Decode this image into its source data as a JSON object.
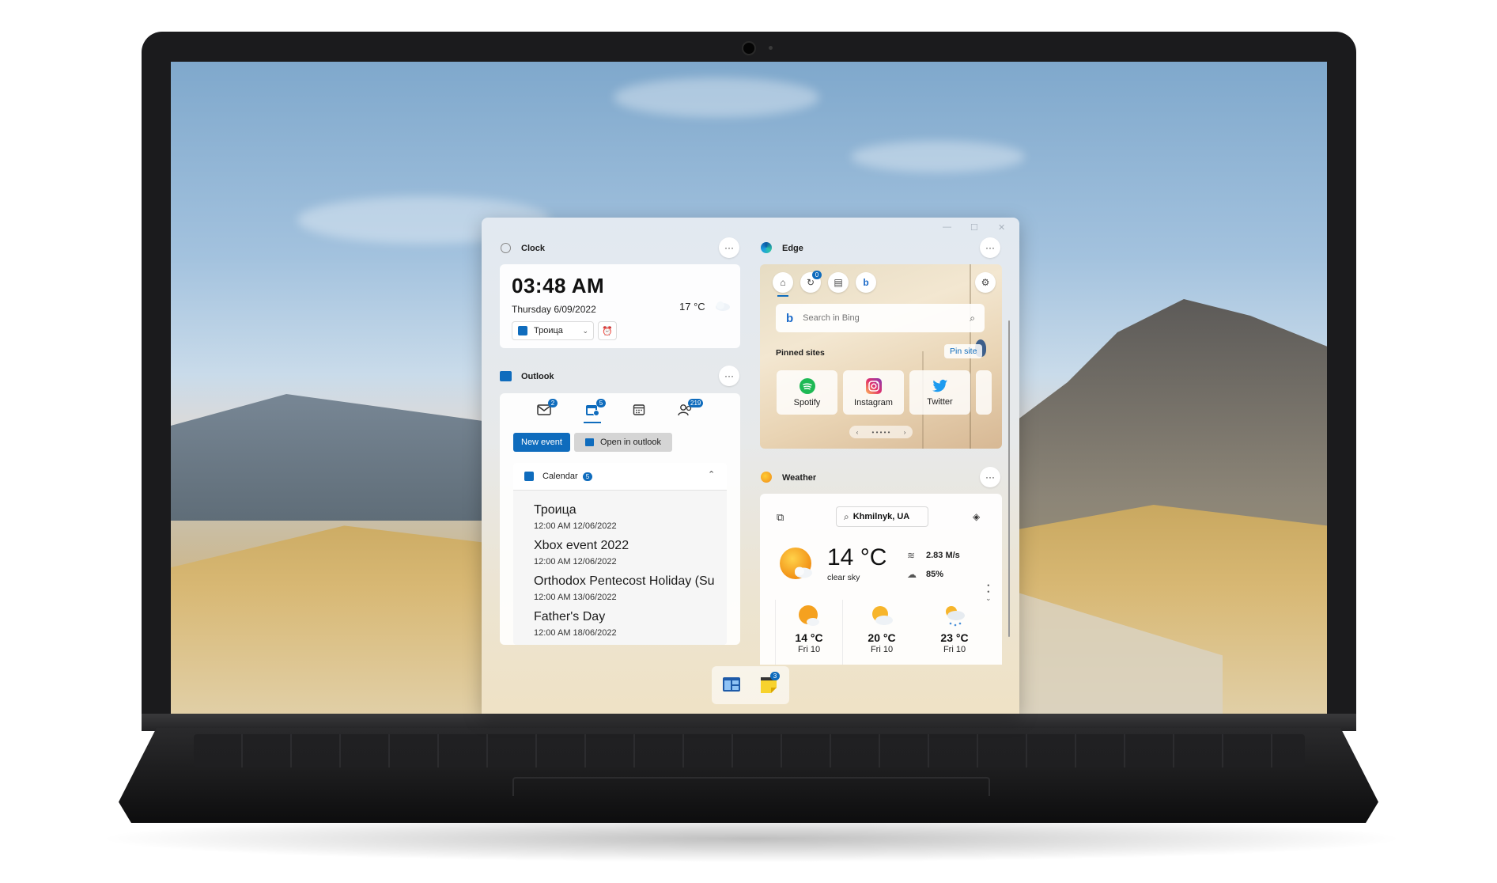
{
  "colors": {
    "accent": "#0f6cbd",
    "board_bg": "#e7e9ea"
  },
  "clock": {
    "title": "Clock",
    "time": "03:48 AM",
    "date": "Thursday 6/09/2022",
    "temperature": "17 °C",
    "event_selector": "Троица",
    "more": "···"
  },
  "outlook": {
    "title": "Outlook",
    "more": "···",
    "tabs": [
      {
        "icon": "mail-icon",
        "badge": "2"
      },
      {
        "icon": "calendar-event-icon",
        "badge": "5"
      },
      {
        "icon": "calendar-icon",
        "badge": ""
      },
      {
        "icon": "contacts-icon",
        "badge": "219"
      }
    ],
    "new_event": "New event",
    "open_in_outlook": "Open in outlook",
    "calendar_label": "Calendar",
    "calendar_count": "5",
    "events": [
      {
        "title": "Троица",
        "time": "12:00 AM 12/06/2022"
      },
      {
        "title": "Xbox event 2022",
        "time": "12:00 AM 12/06/2022"
      },
      {
        "title": "Orthodox Pentecost Holiday (Su",
        "time": "12:00 AM 13/06/2022"
      },
      {
        "title": "Father's Day",
        "time": "12:00 AM 18/06/2022"
      }
    ]
  },
  "edge": {
    "title": "Edge",
    "more": "···",
    "history_badge": "0",
    "search_placeholder": "Search in Bing",
    "pinned_sites_label": "Pinned sites",
    "pin_site": "Pin site",
    "sites": [
      {
        "name": "Spotify",
        "icon": "spotify-icon",
        "color": "#1db954"
      },
      {
        "name": "Instagram",
        "icon": "instagram-icon",
        "color": "#d6249f"
      },
      {
        "name": "Twitter",
        "icon": "twitter-icon",
        "color": "#1d9bf0"
      }
    ]
  },
  "weather": {
    "title": "Weather",
    "more": "···",
    "location": "Khmilnyk, UA",
    "temperature": "14 °C",
    "condition": "clear sky",
    "wind": "2.83  M/s",
    "humidity": "85%",
    "forecast": [
      {
        "temp": "14 °C",
        "day": "Fri 10",
        "icon": "sun-cloud-icon"
      },
      {
        "temp": "20 °C",
        "day": "Fri 10",
        "icon": "partly-cloudy-icon"
      },
      {
        "temp": "23 °C",
        "day": "Fri 10",
        "icon": "cloud-snow-icon"
      }
    ]
  },
  "taskbar": {
    "items": [
      {
        "icon": "widgets-app-icon",
        "badge": ""
      },
      {
        "icon": "sticky-notes-icon",
        "badge": "3"
      }
    ]
  }
}
